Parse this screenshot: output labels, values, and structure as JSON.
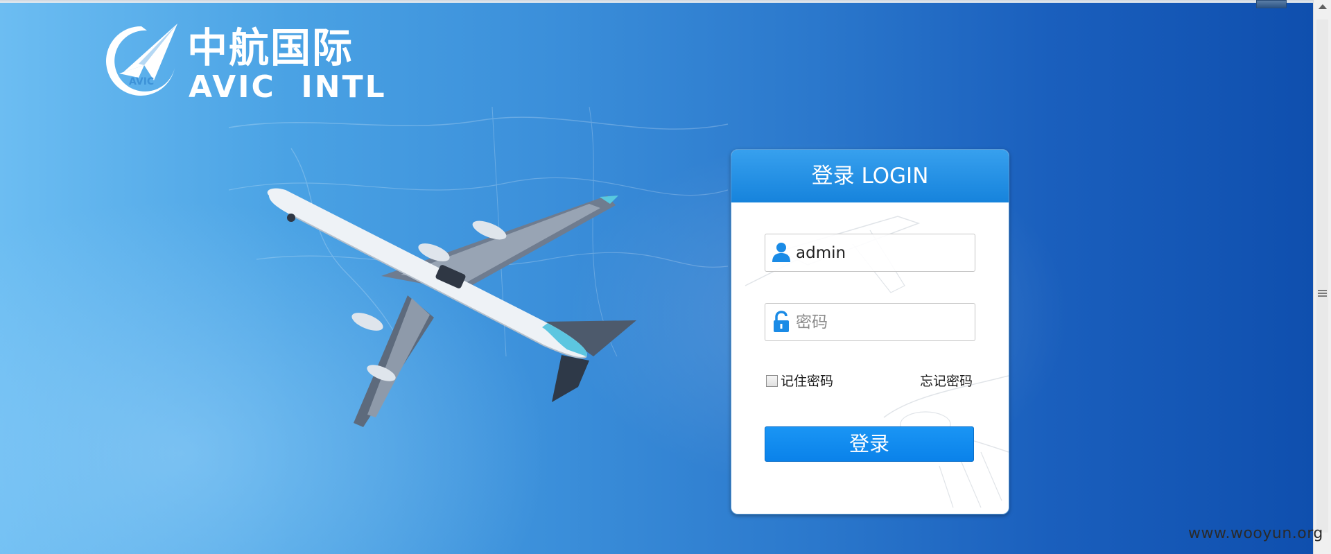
{
  "brand": {
    "cn_name": "中航国际",
    "en_name": "AVIC  INTL",
    "mark_text": "AVIC"
  },
  "login": {
    "title": "登录 LOGIN",
    "username_value": "admin",
    "password_placeholder": "密码",
    "remember_label": "记住密码",
    "remember_checked": false,
    "forgot_label": "忘记密码",
    "submit_label": "登录"
  },
  "watermark": "www.wooyun.org",
  "icons": {
    "username": "user-icon",
    "password": "lock-icon",
    "scroll_up": "scroll-up-arrow-icon",
    "scroll_grip": "scroll-grip-icon"
  },
  "colors": {
    "header_blue": "#1683dc",
    "button_blue": "#0a82ea",
    "icon_blue": "#1a8be6",
    "background_blue": "#2b78cc"
  }
}
